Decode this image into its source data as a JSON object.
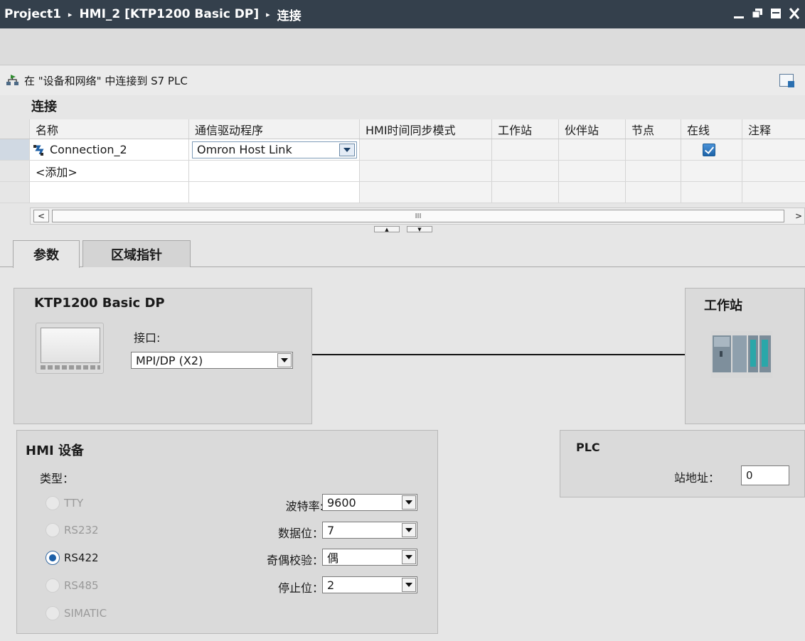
{
  "titlebar": {
    "project": "Project1",
    "device": "HMI_2 [KTP1200 Basic DP]",
    "page": "连接",
    "sep": "▸"
  },
  "connect_bar": {
    "text": "在 \"设备和网络\" 中连接到 S7 PLC"
  },
  "section": {
    "title": "连接"
  },
  "table": {
    "headers": [
      "名称",
      "通信驱动程序",
      "HMI时间同步模式",
      "工作站",
      "伙伴站",
      "节点",
      "在线",
      "注释"
    ],
    "rows": [
      {
        "name": "Connection_2",
        "driver": "Omron Host Link",
        "online": true
      },
      {
        "name": "<添加>"
      }
    ]
  },
  "scrollbar": {
    "thumb_grip": "III",
    "left": "<",
    "right": ">"
  },
  "tabs": [
    "参数",
    "区域指针"
  ],
  "hmi_panel": {
    "title": "KTP1200 Basic DP",
    "interface_label": "接口:",
    "interface_value": "MPI/DP (X2)"
  },
  "station_panel": {
    "title": "工作站"
  },
  "hmi_device": {
    "title": "HMI 设备",
    "type_label": "类型：",
    "types": [
      {
        "label": "TTY",
        "state": "disabled"
      },
      {
        "label": "RS232",
        "state": "disabled"
      },
      {
        "label": "RS422",
        "state": "checked"
      },
      {
        "label": "RS485",
        "state": "disabled"
      },
      {
        "label": "SIMATIC",
        "state": "disabled"
      }
    ],
    "baud_label": "波特率:",
    "baud_value": "9600",
    "databits_label": "数据位：",
    "databits_value": "7",
    "parity_label": "奇偶校验：",
    "parity_value": "偶",
    "stopbits_label": "停止位：",
    "stopbits_value": "2"
  },
  "plc": {
    "title": "PLC",
    "station_addr_label": "站地址：",
    "station_addr_value": "0"
  },
  "colors": {
    "titlebar": "#34404c",
    "panel": "#dadada",
    "accent": "#1b5fa8"
  }
}
